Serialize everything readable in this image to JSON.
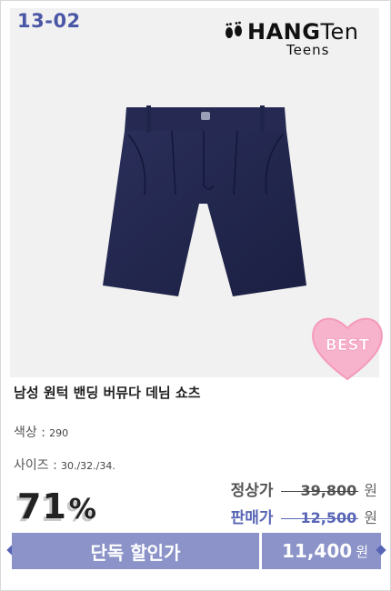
{
  "product": {
    "code": "13-02",
    "brand": {
      "name_bold": "HANG",
      "name_thin": "Ten",
      "sub": "Teens"
    },
    "badge": "BEST",
    "name": "남성 원턱 밴딩 버뮤다 데님 쇼츠",
    "color": {
      "label": "색상 :",
      "value": "290"
    },
    "size": {
      "label": "사이즈 :",
      "value": "30./32./34."
    },
    "discount": {
      "number": "71",
      "unit": "%"
    },
    "regular_price": {
      "label": "정상가",
      "value": "39,800",
      "unit": "원"
    },
    "sale_price": {
      "label": "판매가",
      "value": "12,500",
      "unit": "원"
    },
    "bar": {
      "label": "단독 할인가",
      "price": "11,400",
      "unit": "원"
    }
  },
  "colors": {
    "accent": "#5865b6",
    "bar": "#8b93c8",
    "heart": "#f7b2cc"
  },
  "icons": [
    "footprint-logo-icon",
    "heart-badge-icon"
  ]
}
